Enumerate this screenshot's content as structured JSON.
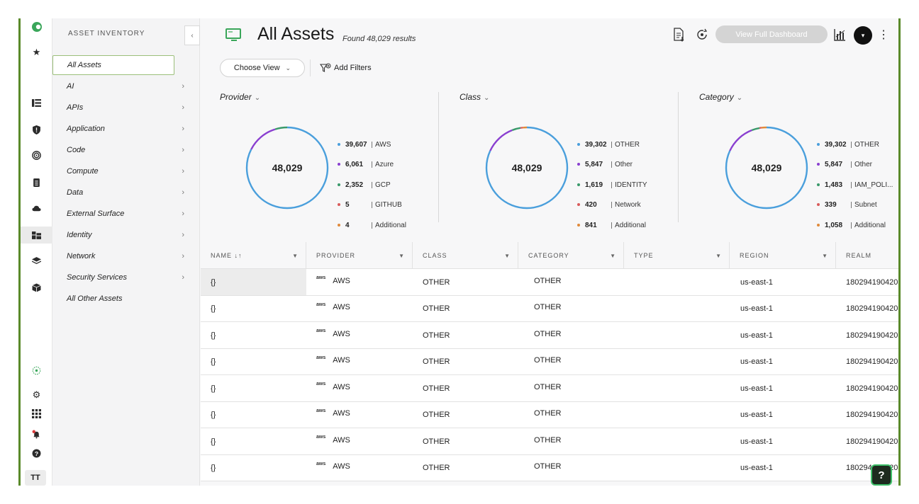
{
  "colors": {
    "accent_green": "#5a8a2a",
    "donut_blue": "#4a9fdc",
    "donut_purple": "#8a3fd0",
    "donut_green": "#3a9a6a",
    "donut_red": "#d95a5a",
    "donut_orange": "#e08a3a"
  },
  "rail": {
    "icons": [
      "logo-icon",
      "star-icon",
      "list-icon",
      "shield-icon",
      "target-icon",
      "clipboard-icon",
      "cloud-icon",
      "inventory-icon",
      "layers-icon",
      "cube-icon",
      "sparkle-icon",
      "gear-icon",
      "grid-icon",
      "bell-icon",
      "help-icon"
    ],
    "user_initials": "TT"
  },
  "nav": {
    "heading": "ASSET INVENTORY",
    "collapse": "‹",
    "items": [
      {
        "label": "All Assets"
      },
      {
        "label": "AI"
      },
      {
        "label": "APIs"
      },
      {
        "label": "Application"
      },
      {
        "label": "Code"
      },
      {
        "label": "Compute"
      },
      {
        "label": "Data"
      },
      {
        "label": "External Surface"
      },
      {
        "label": "Identity"
      },
      {
        "label": "Network"
      },
      {
        "label": "Security Services"
      },
      {
        "label": "All Other Assets"
      }
    ]
  },
  "header": {
    "title": "All Assets",
    "result_count": "Found 48,029 results",
    "dashboard_button": "View Full Dashboard",
    "avatar": "▾"
  },
  "filters": {
    "choose_view": "Choose View",
    "add_filters": "Add Filters"
  },
  "widgets": [
    {
      "title": "Provider",
      "total": "48,029",
      "legend": [
        {
          "value": "39,607",
          "label": "AWS",
          "color": "#4a9fdc"
        },
        {
          "value": "6,061",
          "label": "Azure",
          "color": "#8a3fd0"
        },
        {
          "value": "2,352",
          "label": "GCP",
          "color": "#3a9a6a"
        },
        {
          "value": "5",
          "label": "GITHUB",
          "color": "#d95a5a"
        },
        {
          "value": "4",
          "label": "Additional",
          "color": "#e08a3a"
        }
      ]
    },
    {
      "title": "Class",
      "total": "48,029",
      "legend": [
        {
          "value": "39,302",
          "label": "OTHER",
          "color": "#4a9fdc"
        },
        {
          "value": "5,847",
          "label": "Other",
          "color": "#8a3fd0"
        },
        {
          "value": "1,619",
          "label": "IDENTITY",
          "color": "#3a9a6a"
        },
        {
          "value": "420",
          "label": "Network",
          "color": "#d95a5a"
        },
        {
          "value": "841",
          "label": "Additional",
          "color": "#e08a3a"
        }
      ]
    },
    {
      "title": "Category",
      "total": "48,029",
      "legend": [
        {
          "value": "39,302",
          "label": "OTHER",
          "color": "#4a9fdc"
        },
        {
          "value": "5,847",
          "label": "Other",
          "color": "#8a3fd0"
        },
        {
          "value": "1,483",
          "label": "IAM_POLI...",
          "color": "#3a9a6a"
        },
        {
          "value": "339",
          "label": "Subnet",
          "color": "#d95a5a"
        },
        {
          "value": "1,058",
          "label": "Additional",
          "color": "#e08a3a"
        }
      ]
    }
  ],
  "table": {
    "columns": [
      "NAME ↓↑",
      "PROVIDER",
      "CLASS",
      "CATEGORY",
      "TYPE",
      "REGION",
      "REALM"
    ],
    "rows": [
      {
        "name": "{}",
        "provider_logo": "aws",
        "provider": "AWS",
        "class": "OTHER",
        "category": "OTHER",
        "type": "",
        "region": "us-east-1",
        "realm": "180294190420"
      },
      {
        "name": "{}",
        "provider_logo": "aws",
        "provider": "AWS",
        "class": "OTHER",
        "category": "OTHER",
        "type": "",
        "region": "us-east-1",
        "realm": "180294190420"
      },
      {
        "name": "{}",
        "provider_logo": "aws",
        "provider": "AWS",
        "class": "OTHER",
        "category": "OTHER",
        "type": "",
        "region": "us-east-1",
        "realm": "180294190420"
      },
      {
        "name": "{}",
        "provider_logo": "aws",
        "provider": "AWS",
        "class": "OTHER",
        "category": "OTHER",
        "type": "",
        "region": "us-east-1",
        "realm": "180294190420"
      },
      {
        "name": "{}",
        "provider_logo": "aws",
        "provider": "AWS",
        "class": "OTHER",
        "category": "OTHER",
        "type": "",
        "region": "us-east-1",
        "realm": "180294190420"
      },
      {
        "name": "{}",
        "provider_logo": "aws",
        "provider": "AWS",
        "class": "OTHER",
        "category": "OTHER",
        "type": "",
        "region": "us-east-1",
        "realm": "180294190420"
      },
      {
        "name": "{}",
        "provider_logo": "aws",
        "provider": "AWS",
        "class": "OTHER",
        "category": "OTHER",
        "type": "",
        "region": "us-east-1",
        "realm": "180294190420"
      },
      {
        "name": "{}",
        "provider_logo": "aws",
        "provider": "AWS",
        "class": "OTHER",
        "category": "OTHER",
        "type": "",
        "region": "us-east-1",
        "realm": "180294190420"
      }
    ]
  },
  "help_button": "?"
}
